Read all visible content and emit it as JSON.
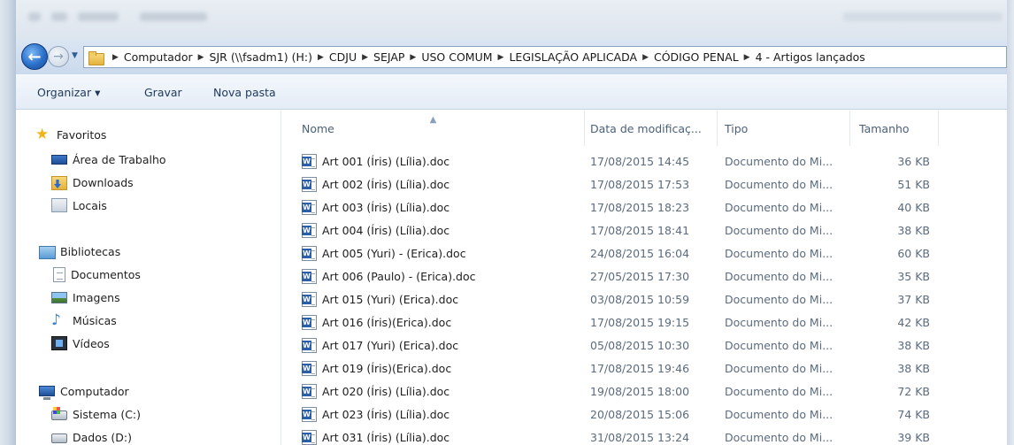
{
  "address": {
    "crumbs": [
      "Computador",
      "SJR (\\\\fsadm1) (H:)",
      "CDJU",
      "SEJAP",
      "USO COMUM",
      "LEGISLAÇÃO APLICADA",
      "CÓDIGO PENAL",
      "4 - Artigos lançados"
    ]
  },
  "toolbar": {
    "organize": "Organizar ▾",
    "burn": "Gravar",
    "new_folder": "Nova pasta"
  },
  "nav": {
    "favorites": "Favoritos",
    "desktop": "Área de Trabalho",
    "downloads": "Downloads",
    "locais": "Locais",
    "libraries": "Bibliotecas",
    "documents": "Documentos",
    "images": "Imagens",
    "music": "Músicas",
    "videos": "Vídeos",
    "computer": "Computador",
    "drive_c": "Sistema (C:)",
    "drive_d": "Dados (D:)"
  },
  "columns": {
    "name": "Nome",
    "date": "Data de modificaç...",
    "type": "Tipo",
    "size": "Tamanho"
  },
  "files": [
    {
      "name": "Art 001 (Íris) (Lília).doc",
      "date": "17/08/2015 14:45",
      "type": "Documento do Mi...",
      "size": "36 KB"
    },
    {
      "name": "Art 002 (Íris) (Lília).doc",
      "date": "17/08/2015 17:53",
      "type": "Documento do Mi...",
      "size": "51 KB"
    },
    {
      "name": "Art 003 (Íris) (Lília).doc",
      "date": "17/08/2015 18:23",
      "type": "Documento do Mi...",
      "size": "40 KB"
    },
    {
      "name": "Art 004 (Íris) (Lília).doc",
      "date": "17/08/2015 18:41",
      "type": "Documento do Mi...",
      "size": "38 KB"
    },
    {
      "name": "Art 005 (Yuri) - (Erica).doc",
      "date": "24/08/2015 16:04",
      "type": "Documento do Mi...",
      "size": "60 KB"
    },
    {
      "name": "Art 006 (Paulo) - (Erica).doc",
      "date": "27/05/2015 17:30",
      "type": "Documento do Mi...",
      "size": "35 KB"
    },
    {
      "name": "Art 015 (Yuri) (Erica).doc",
      "date": "03/08/2015 10:59",
      "type": "Documento do Mi...",
      "size": "37 KB"
    },
    {
      "name": "Art 016 (Íris)(Erica).doc",
      "date": "17/08/2015 19:15",
      "type": "Documento do Mi...",
      "size": "42 KB"
    },
    {
      "name": "Art 017 (Yuri) (Erica).doc",
      "date": "05/08/2015 10:30",
      "type": "Documento do Mi...",
      "size": "38 KB"
    },
    {
      "name": "Art 019 (Íris)(Erica).doc",
      "date": "17/08/2015 19:46",
      "type": "Documento do Mi...",
      "size": "38 KB"
    },
    {
      "name": "Art 020 (Íris) (Lília).doc",
      "date": "19/08/2015 18:00",
      "type": "Documento do Mi...",
      "size": "72 KB"
    },
    {
      "name": "Art 023 (Íris) (Lília).doc",
      "date": "20/08/2015 15:06",
      "type": "Documento do Mi...",
      "size": "74 KB"
    },
    {
      "name": "Art 031 (Íris) (Lília).doc",
      "date": "31/08/2015 13:24",
      "type": "Documento do Mi...",
      "size": "39 KB"
    }
  ]
}
